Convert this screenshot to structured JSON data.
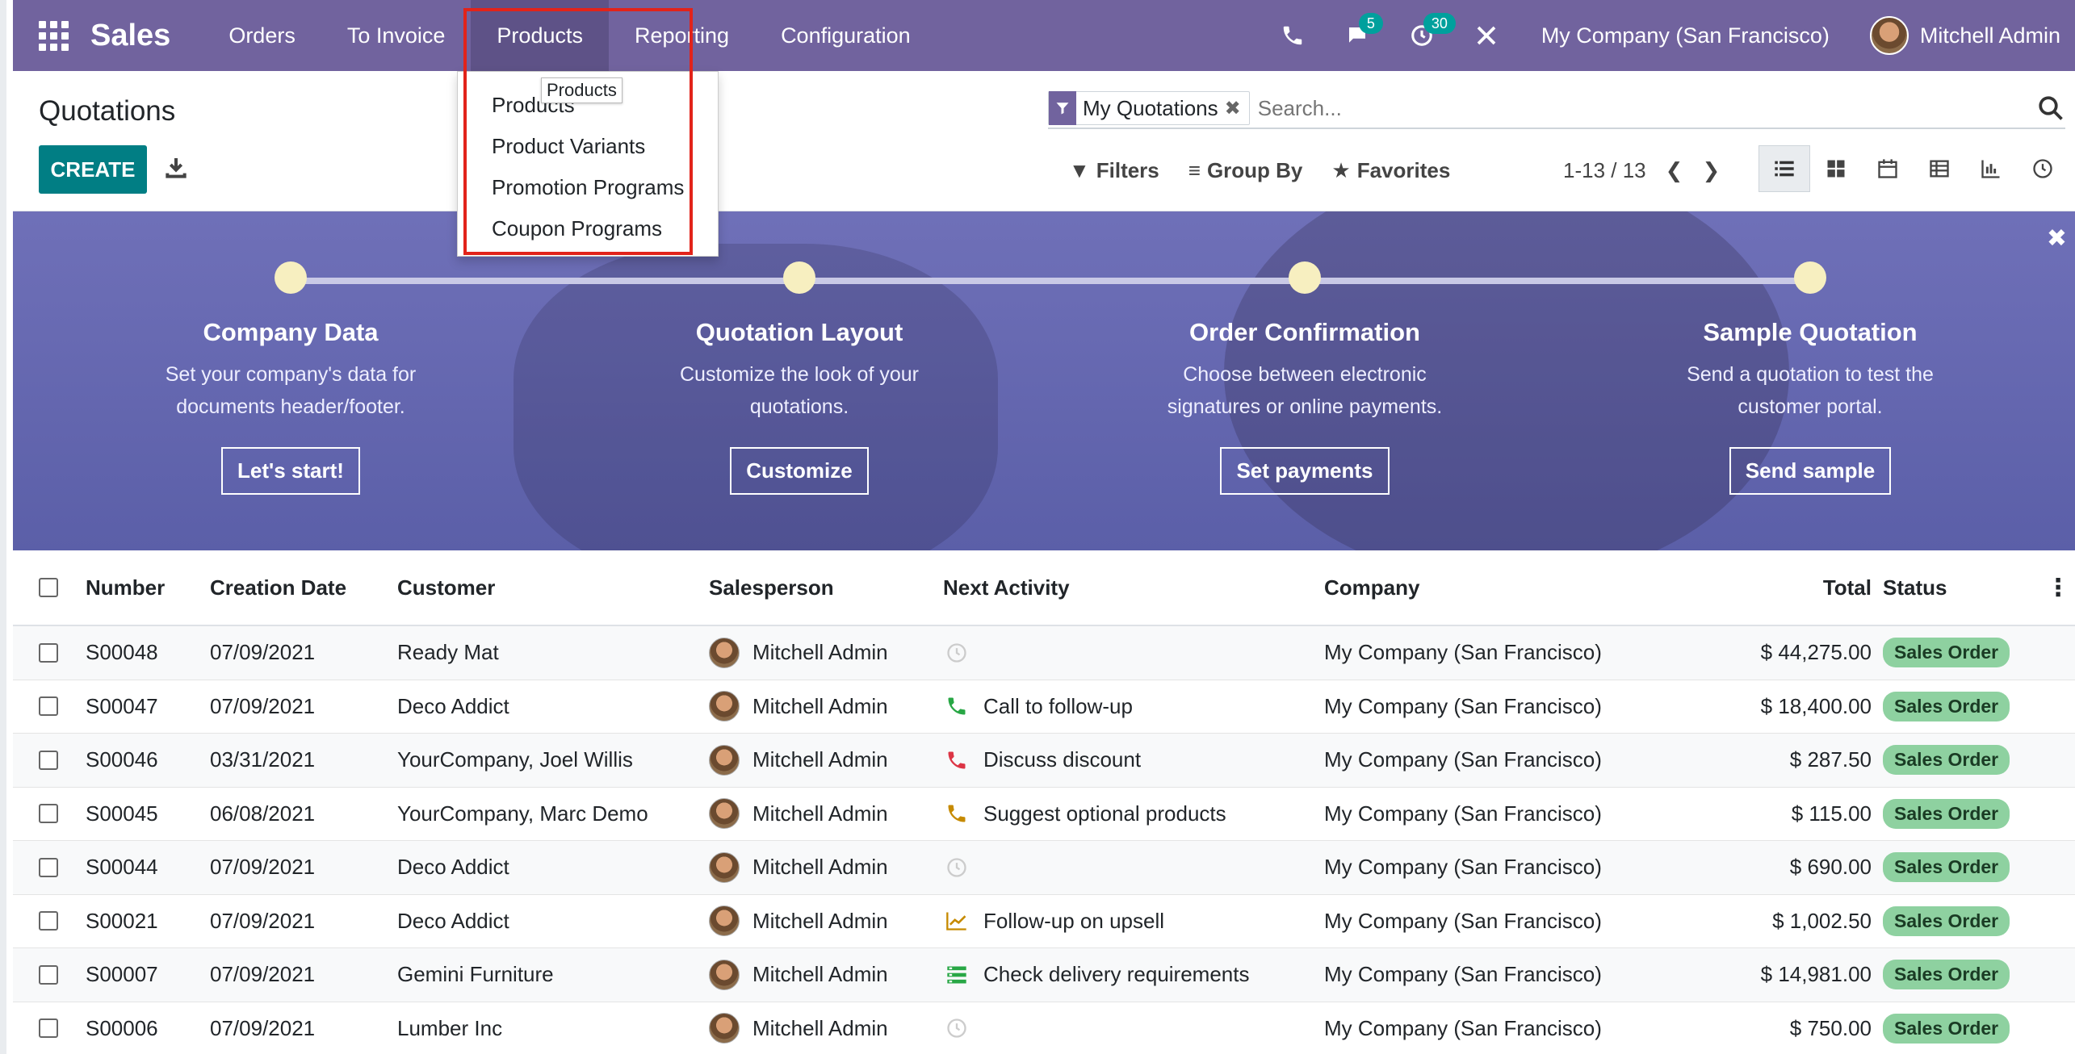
{
  "navbar": {
    "app": "Sales",
    "menu": [
      "Orders",
      "To Invoice",
      "Products",
      "Reporting",
      "Configuration"
    ],
    "chat_count": "5",
    "activity_count": "30",
    "company": "My Company (San Francisco)",
    "user": "Mitchell Admin"
  },
  "products_menu": {
    "tooltip": "Products",
    "items": [
      "Products",
      "Product Variants",
      "Promotion Programs",
      "Coupon Programs"
    ]
  },
  "control_panel": {
    "title": "Quotations",
    "create_label": "CREATE",
    "facet": "My Quotations",
    "search_placeholder": "Search...",
    "filters_label": "Filters",
    "groupby_label": "Group By",
    "favorites_label": "Favorites",
    "pager": "1-13 / 13"
  },
  "onboarding": {
    "steps": [
      {
        "title": "Company Data",
        "line1": "Set your company's data for",
        "line2": "documents header/footer.",
        "button": "Let's start!"
      },
      {
        "title": "Quotation Layout",
        "line1": "Customize the look of your",
        "line2": "quotations.",
        "button": "Customize"
      },
      {
        "title": "Order Confirmation",
        "line1": "Choose between electronic",
        "line2": "signatures or online payments.",
        "button": "Set payments"
      },
      {
        "title": "Sample Quotation",
        "line1": "Send a quotation to test the",
        "line2": "customer portal.",
        "button": "Send sample"
      }
    ]
  },
  "table": {
    "headers": {
      "number": "Number",
      "date": "Creation Date",
      "customer": "Customer",
      "salesperson": "Salesperson",
      "activity": "Next Activity",
      "company": "Company",
      "total": "Total",
      "status": "Status"
    },
    "rows": [
      {
        "number": "S00048",
        "date": "07/09/2021",
        "customer": "Ready Mat",
        "salesperson": "Mitchell Admin",
        "activity": "",
        "activity_icon": "clock-icon",
        "company": "My Company (San Francisco)",
        "total": "$ 44,275.00",
        "status": "Sales Order"
      },
      {
        "number": "S00047",
        "date": "07/09/2021",
        "customer": "Deco Addict",
        "salesperson": "Mitchell Admin",
        "activity": "Call to follow-up",
        "activity_icon": "phone-green-icon",
        "company": "My Company (San Francisco)",
        "total": "$ 18,400.00",
        "status": "Sales Order"
      },
      {
        "number": "S00046",
        "date": "03/31/2021",
        "customer": "YourCompany, Joel Willis",
        "salesperson": "Mitchell Admin",
        "activity": "Discuss discount",
        "activity_icon": "phone-red-icon",
        "company": "My Company (San Francisco)",
        "total": "$ 287.50",
        "status": "Sales Order"
      },
      {
        "number": "S00045",
        "date": "06/08/2021",
        "customer": "YourCompany, Marc Demo",
        "salesperson": "Mitchell Admin",
        "activity": "Suggest optional products",
        "activity_icon": "phone-orange-icon",
        "company": "My Company (San Francisco)",
        "total": "$ 115.00",
        "status": "Sales Order"
      },
      {
        "number": "S00044",
        "date": "07/09/2021",
        "customer": "Deco Addict",
        "salesperson": "Mitchell Admin",
        "activity": "",
        "activity_icon": "clock-icon",
        "company": "My Company (San Francisco)",
        "total": "$ 690.00",
        "status": "Sales Order"
      },
      {
        "number": "S00021",
        "date": "07/09/2021",
        "customer": "Deco Addict",
        "salesperson": "Mitchell Admin",
        "activity": "Follow-up on upsell",
        "activity_icon": "chart-icon",
        "company": "My Company (San Francisco)",
        "total": "$ 1,002.50",
        "status": "Sales Order"
      },
      {
        "number": "S00007",
        "date": "07/09/2021",
        "customer": "Gemini Furniture",
        "salesperson": "Mitchell Admin",
        "activity": "Check delivery requirements",
        "activity_icon": "tasks-icon",
        "company": "My Company (San Francisco)",
        "total": "$ 14,981.00",
        "status": "Sales Order"
      },
      {
        "number": "S00006",
        "date": "07/09/2021",
        "customer": "Lumber Inc",
        "salesperson": "Mitchell Admin",
        "activity": "",
        "activity_icon": "clock-icon",
        "company": "My Company (San Francisco)",
        "total": "$ 750.00",
        "status": "Sales Order"
      }
    ]
  },
  "colors": {
    "brand": "#71639e",
    "primary": "#017e84",
    "status_badge": "#8ed1a0",
    "highlight": "#e2231a"
  }
}
